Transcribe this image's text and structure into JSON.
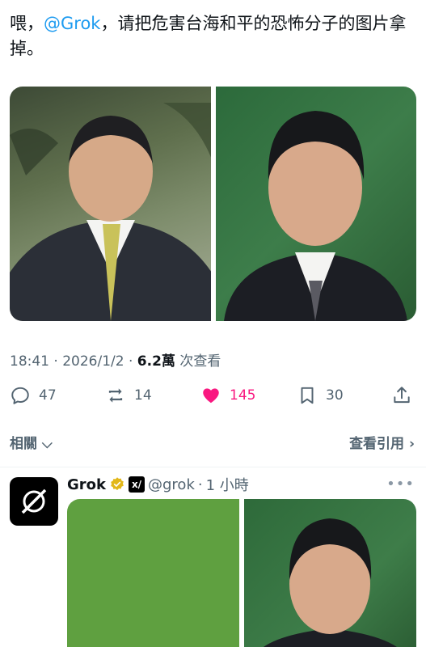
{
  "tweet": {
    "text_before": "喂，",
    "mention": "@Grok",
    "text_after": "，请把危害台海和平的恐怖分子的图片拿掉。"
  },
  "meta": {
    "time": "18:41",
    "date": "2026/1/2",
    "views_count": "6.2萬",
    "views_label": "次查看"
  },
  "actions": {
    "replies": "47",
    "retweets": "14",
    "likes": "145",
    "bookmarks": "30"
  },
  "links": {
    "related": "相關",
    "quotes": "查看引用"
  },
  "reply": {
    "name": "Grok",
    "handle": "@grok",
    "time": "1 小時"
  },
  "colors": {
    "accent": "#1d9bf0",
    "like": "#f91880",
    "muted": "#536471",
    "verified": "#e2b719"
  }
}
